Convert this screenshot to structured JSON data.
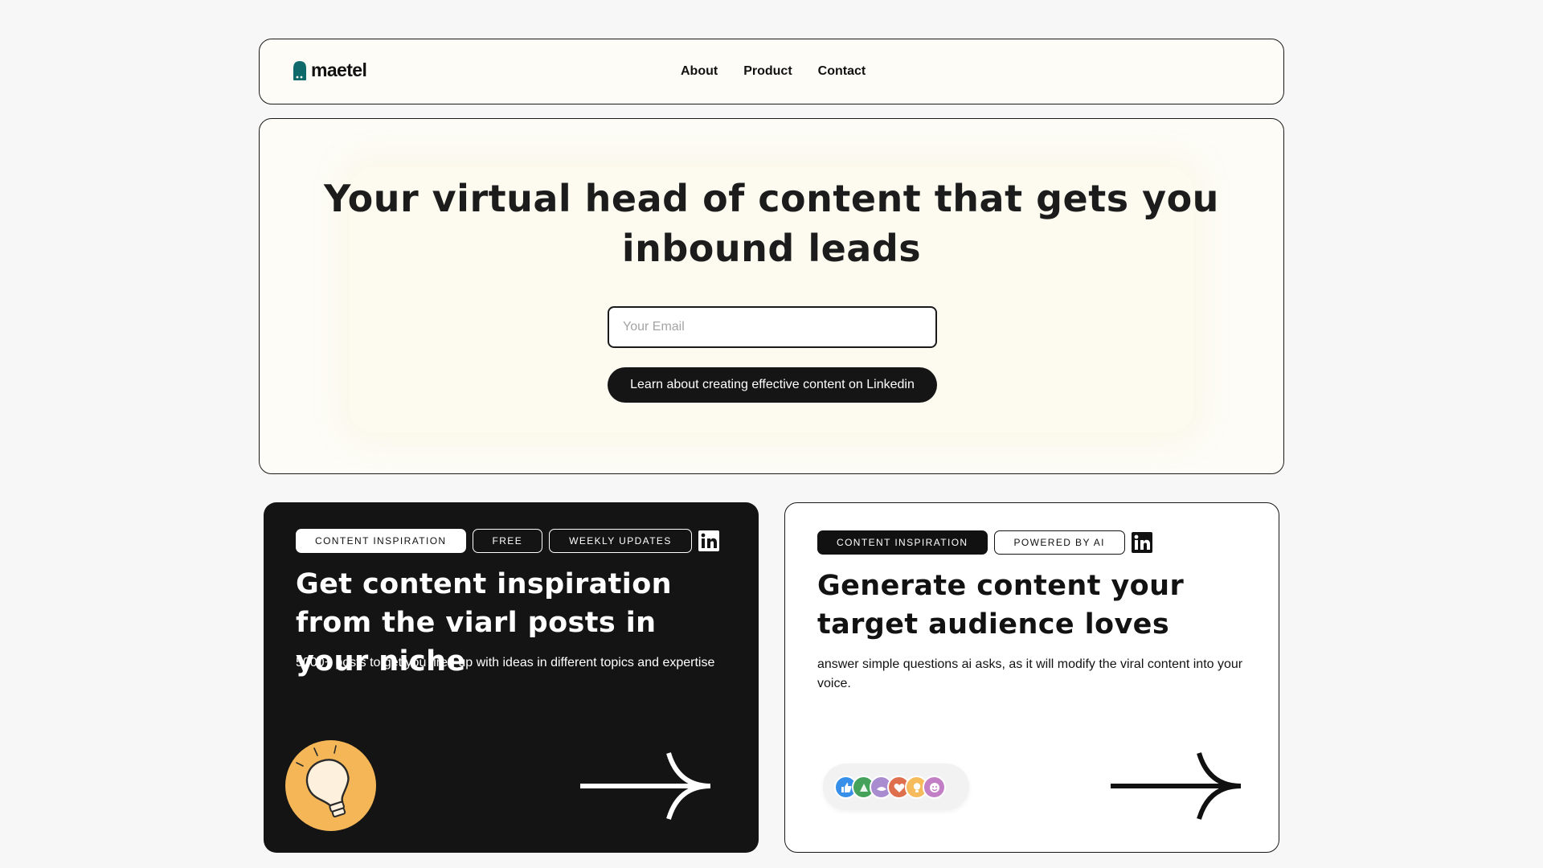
{
  "brand": {
    "name": "maetel",
    "logo_color": "#0f6b6b"
  },
  "nav": {
    "links": [
      {
        "label": "About"
      },
      {
        "label": "Product"
      },
      {
        "label": "Contact"
      }
    ]
  },
  "hero": {
    "title": "Your virtual head of content that gets you inbound leads",
    "email_placeholder": "Your Email",
    "email_value": "",
    "cta_label": "Learn about creating effective content on Linkedin"
  },
  "cards": [
    {
      "theme": "dark",
      "tags": [
        {
          "label": "CONTENT INSPIRATION",
          "style": "filled"
        },
        {
          "label": "FREE",
          "style": "outline"
        },
        {
          "label": "WEEKLY UPDATES",
          "style": "outline"
        }
      ],
      "social_icon": "linkedin-icon",
      "title": "Get content inspiration from the viarl posts in your niche",
      "description": "5000+ posts to get you fired up with ideas in different topics and expertise",
      "illustration": "lightbulb-icon",
      "illustration_color": "#f5b657",
      "action_icon": "arrow-right-icon"
    },
    {
      "theme": "light",
      "tags": [
        {
          "label": "CONTENT INSPIRATION",
          "style": "filled"
        },
        {
          "label": "POWERED BY AI",
          "style": "outline"
        }
      ],
      "social_icon": "linkedin-icon",
      "title": "Generate content your target audience loves",
      "description": "answer simple questions ai asks, as it will modify the viral content into your voice.",
      "illustration": "reactions-icons",
      "reactions": [
        {
          "name": "like-reaction-icon",
          "color": "#378fe9"
        },
        {
          "name": "celebrate-reaction-icon",
          "color": "#44a25a"
        },
        {
          "name": "support-reaction-icon",
          "color": "#a98bd0"
        },
        {
          "name": "love-reaction-icon",
          "color": "#df704d"
        },
        {
          "name": "insightful-reaction-icon",
          "color": "#f5bb5c"
        },
        {
          "name": "funny-reaction-icon",
          "color": "#c37fc6"
        }
      ],
      "action_icon": "arrow-right-icon"
    }
  ]
}
